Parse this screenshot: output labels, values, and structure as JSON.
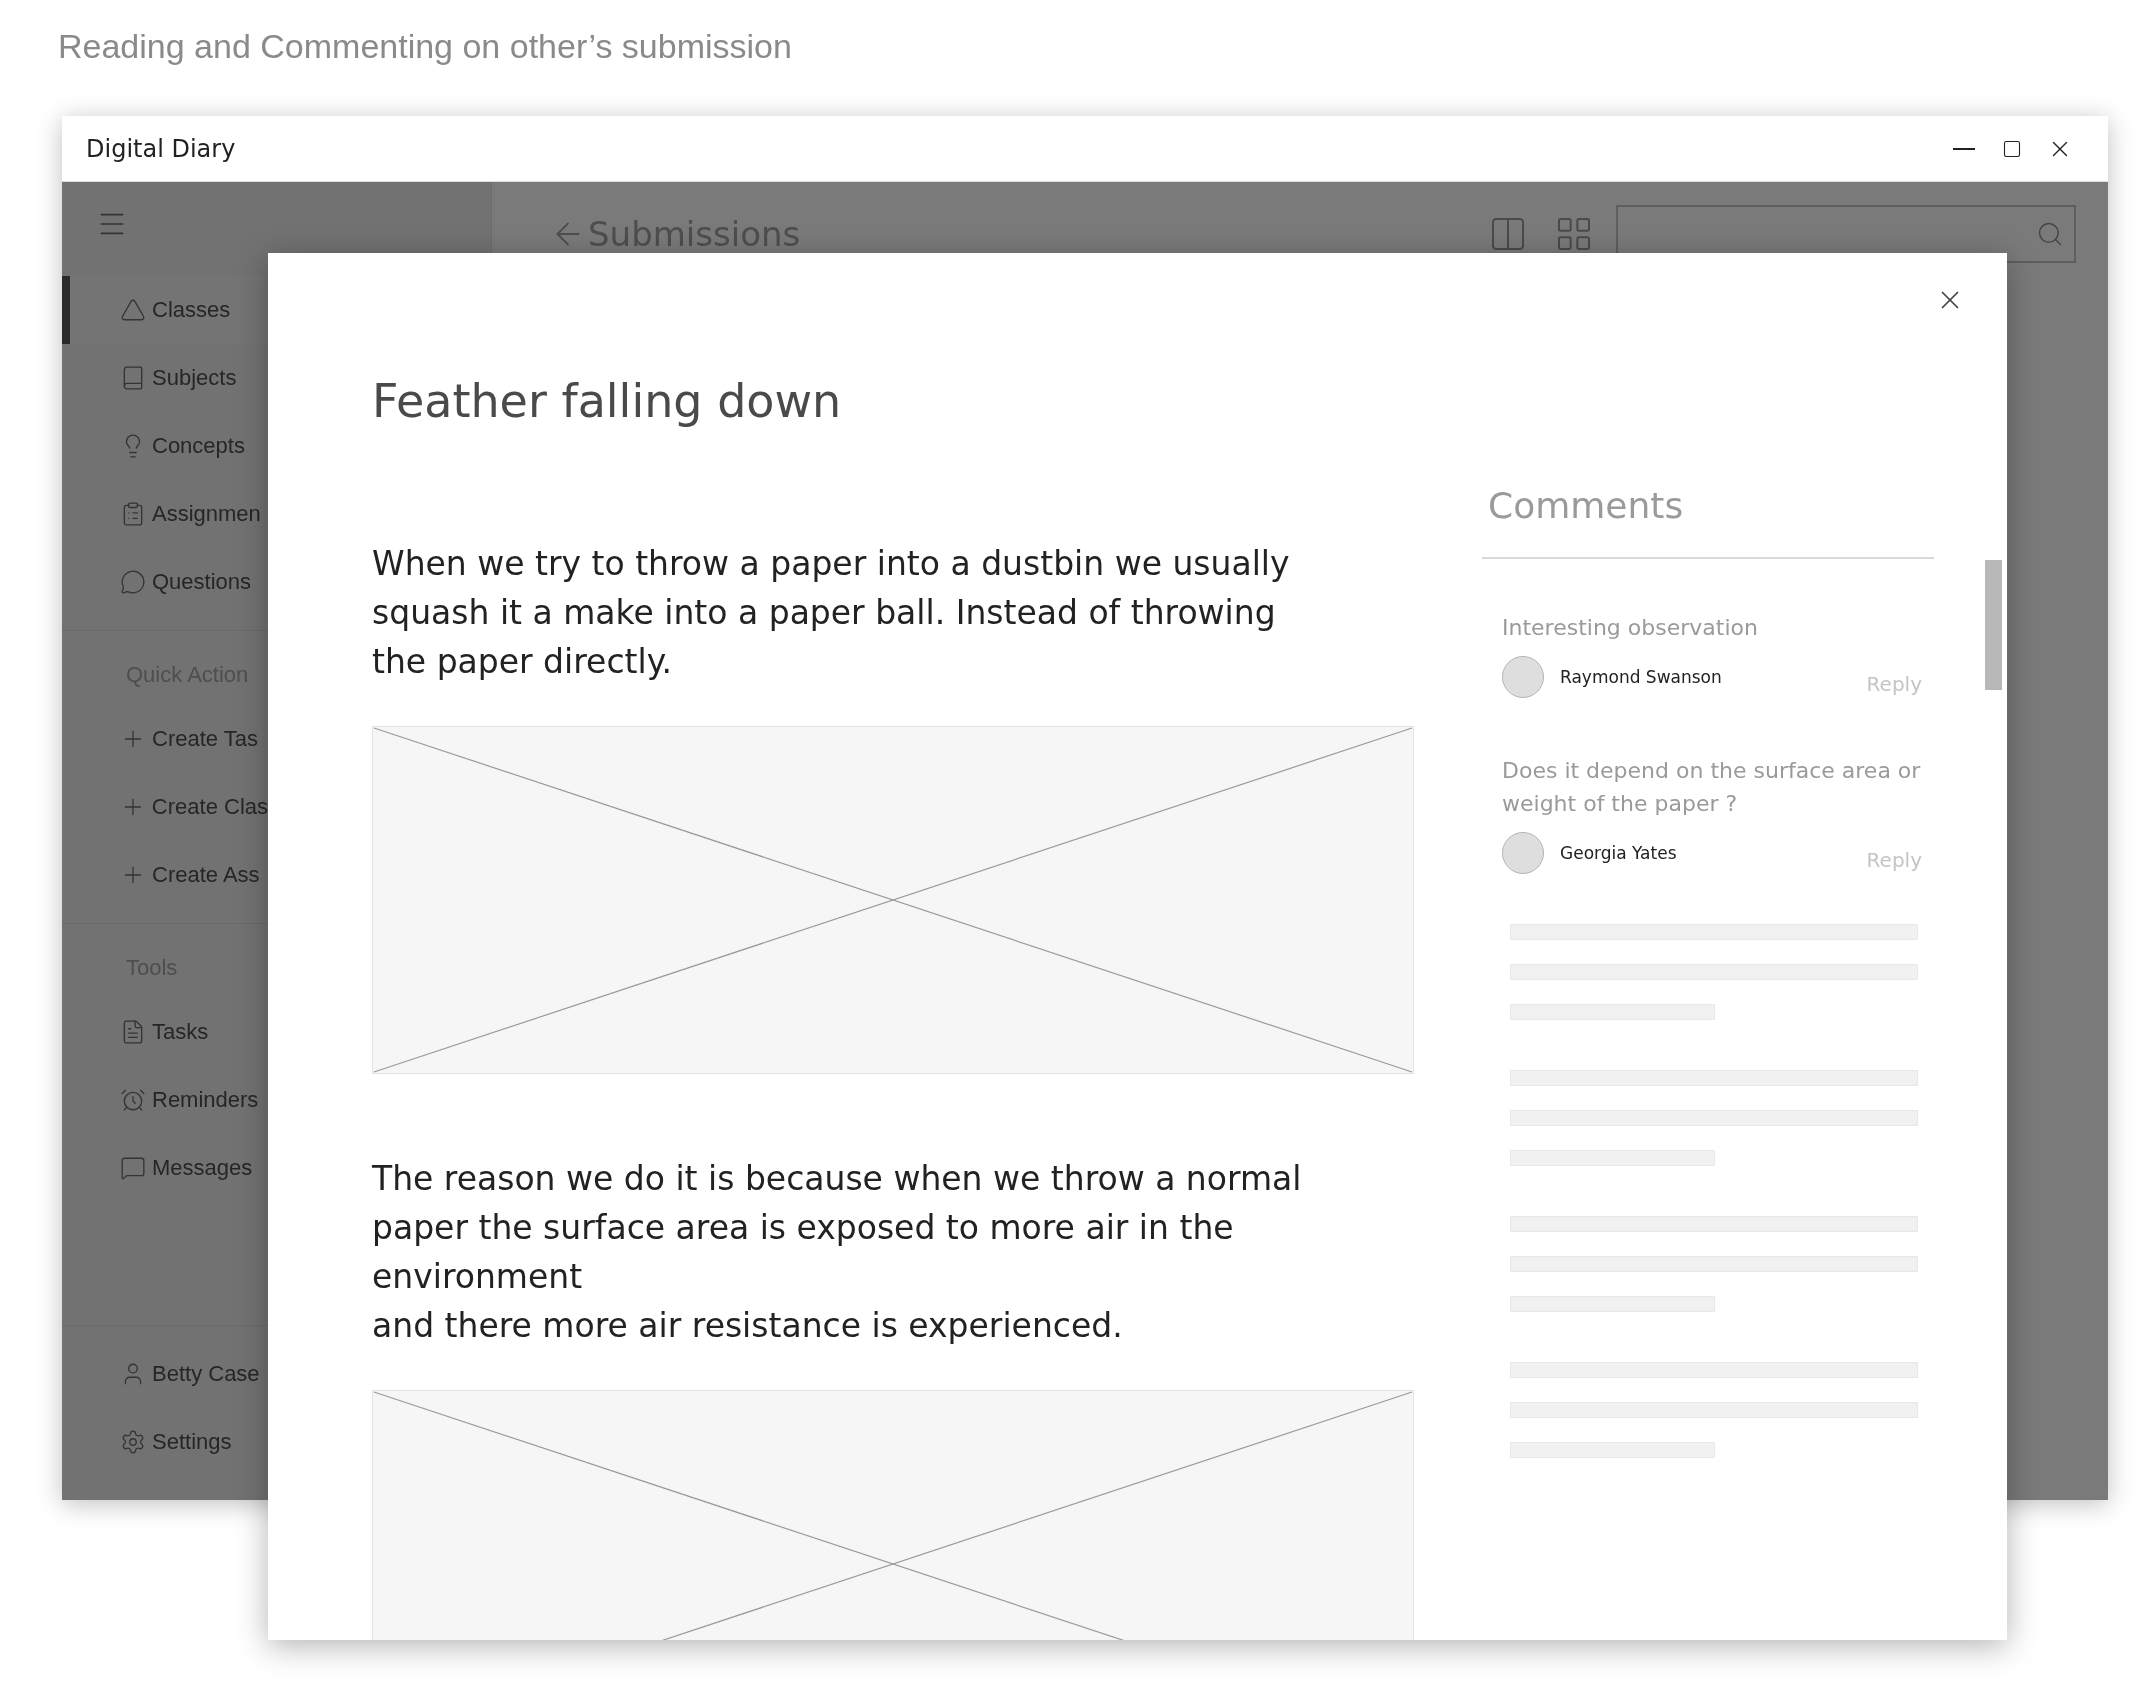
{
  "caption": "Reading and Commenting on other’s submission",
  "window": {
    "title": "Digital Diary"
  },
  "sidebar": {
    "nav": [
      {
        "label": "Classes",
        "selected": true
      },
      {
        "label": "Subjects",
        "selected": false
      },
      {
        "label": "Concepts",
        "selected": false
      },
      {
        "label": "Assignmen",
        "selected": false
      },
      {
        "label": "Questions",
        "selected": false
      }
    ],
    "sections": [
      {
        "title": "Quick Action",
        "items": [
          {
            "label": "Create Tas",
            "selected": false
          },
          {
            "label": "Create Clas",
            "selected": false
          },
          {
            "label": "Create Ass",
            "selected": false
          }
        ]
      },
      {
        "title": "Tools",
        "items": [
          {
            "label": "Tasks",
            "selected": false
          },
          {
            "label": "Reminders",
            "selected": false
          },
          {
            "label": "Messages",
            "selected": false
          }
        ]
      }
    ],
    "footer": [
      {
        "label": "Betty Case",
        "selected": false
      },
      {
        "label": "Settings",
        "selected": false
      }
    ]
  },
  "header": {
    "back_title": "Submissions"
  },
  "dialog": {
    "title": "Feather falling down",
    "blocks": [
      {
        "kind": "text",
        "text": "When we try to throw a paper into a dustbin we usually squash it a make into a paper ball. Instead of throwing the paper directly."
      },
      {
        "kind": "image"
      },
      {
        "kind": "text",
        "text": "The reason we do it is because when we throw a normal paper the surface area is exposed to more air in the environment\nand there more air resistance is experienced."
      },
      {
        "kind": "image"
      }
    ],
    "comments_title": "Comments",
    "comments": [
      {
        "text": "Interesting observation",
        "author": "Raymond Swanson",
        "reply": "Reply"
      },
      {
        "text": "Does it depend on the surface area or weight of the paper ?",
        "author": "Georgia Yates",
        "reply": "Reply"
      }
    ]
  }
}
